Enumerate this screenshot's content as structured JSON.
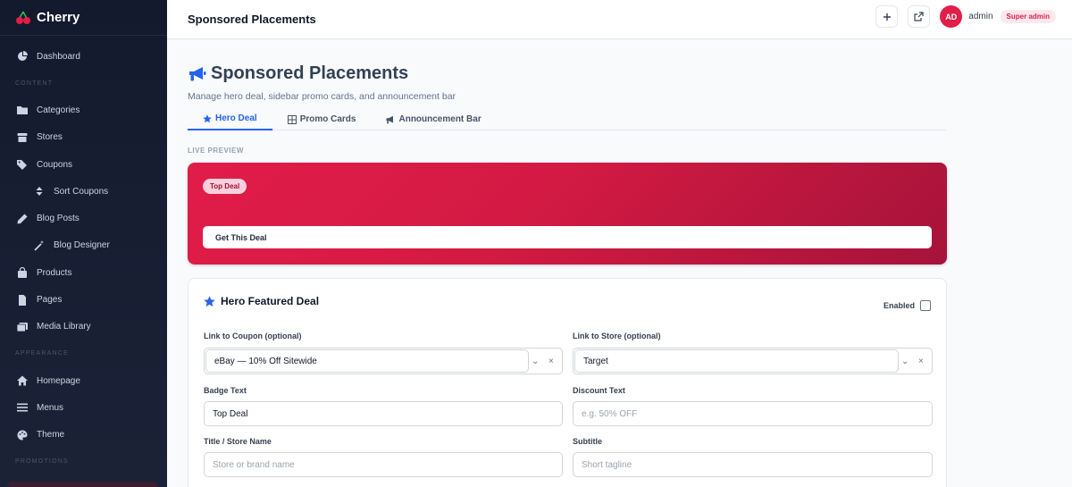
{
  "brand": {
    "name": "Cherry"
  },
  "sidebar": {
    "items": [
      {
        "label": "Dashboard",
        "icon": "chart-pie-icon"
      },
      {
        "label": "Categories",
        "icon": "folder-icon"
      },
      {
        "label": "Stores",
        "icon": "store-icon"
      },
      {
        "label": "Coupons",
        "icon": "tags-icon"
      },
      {
        "label": "Sort Coupons",
        "icon": "sort-icon"
      },
      {
        "label": "Blog Posts",
        "icon": "pen-icon"
      },
      {
        "label": "Blog Designer",
        "icon": "magic-wand-icon"
      },
      {
        "label": "Products",
        "icon": "bag-icon"
      },
      {
        "label": "Pages",
        "icon": "file-icon"
      },
      {
        "label": "Media Library",
        "icon": "images-icon"
      },
      {
        "label": "Homepage",
        "icon": "home-icon"
      },
      {
        "label": "Menus",
        "icon": "bars-icon"
      },
      {
        "label": "Theme",
        "icon": "palette-icon"
      }
    ],
    "sections": {
      "content": "CONTENT",
      "appearance": "APPEARANCE",
      "promotions": "PROMOTIONS"
    }
  },
  "header": {
    "title": "Sponsored Placements",
    "user": "admin",
    "avatar_initials": "AD",
    "role": "Super admin"
  },
  "page": {
    "title": "Sponsored Placements",
    "subtitle": "Manage hero deal, sidebar promo cards, and announcement bar",
    "tabs": [
      {
        "label": "Hero Deal",
        "icon": "star-icon",
        "active": true
      },
      {
        "label": "Promo Cards",
        "icon": "grid-icon",
        "active": false
      },
      {
        "label": "Announcement Bar",
        "icon": "megaphone-icon",
        "active": false
      }
    ],
    "live_preview_label": "LIVE PREVIEW"
  },
  "preview": {
    "badge": "Top Deal",
    "cta": "Get This Deal"
  },
  "form": {
    "card_title": "Hero Featured Deal",
    "enabled_label": "Enabled",
    "enabled": false,
    "coupon_label": "Link to Coupon (optional)",
    "coupon_value": "eBay — 10% Off Sitewide",
    "store_label": "Link to Store (optional)",
    "store_value": "Target",
    "badge_label": "Badge Text",
    "badge_value": "Top Deal",
    "discount_label": "Discount Text",
    "discount_placeholder": "e.g. 50% OFF",
    "title_label": "Title / Store Name",
    "title_placeholder": "Store or brand name",
    "subtitle_label": "Subtitle",
    "subtitle_placeholder": "Short tagline"
  },
  "colors": {
    "accent": "#e11d48",
    "primary": "#2563eb",
    "sidebar_bg": "#141a2e"
  }
}
